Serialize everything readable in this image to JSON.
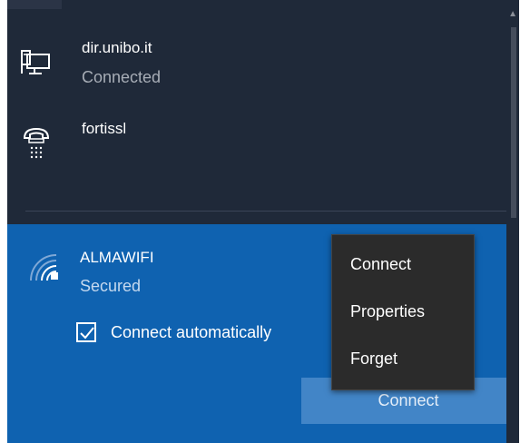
{
  "networks": [
    {
      "name": "dir.unibo.it",
      "status": "Connected",
      "icon": "vpn-computer-icon"
    },
    {
      "name": "fortissl",
      "status": "",
      "icon": "dialup-phone-icon"
    }
  ],
  "selected_network": {
    "name": "ALMAWIFI",
    "status": "Secured",
    "icon": "wifi-signal-secured-icon",
    "connect_automatically_label": "Connect automatically",
    "connect_automatically_checked": true,
    "connect_button_label": "Connect"
  },
  "context_menu": {
    "items": [
      "Connect",
      "Properties",
      "Forget"
    ]
  },
  "colors": {
    "flyout_bg": "#1f2939",
    "selected_bg": "#0f62b0",
    "button_bg": "#4285c7",
    "menu_bg": "#2b2b2b"
  }
}
